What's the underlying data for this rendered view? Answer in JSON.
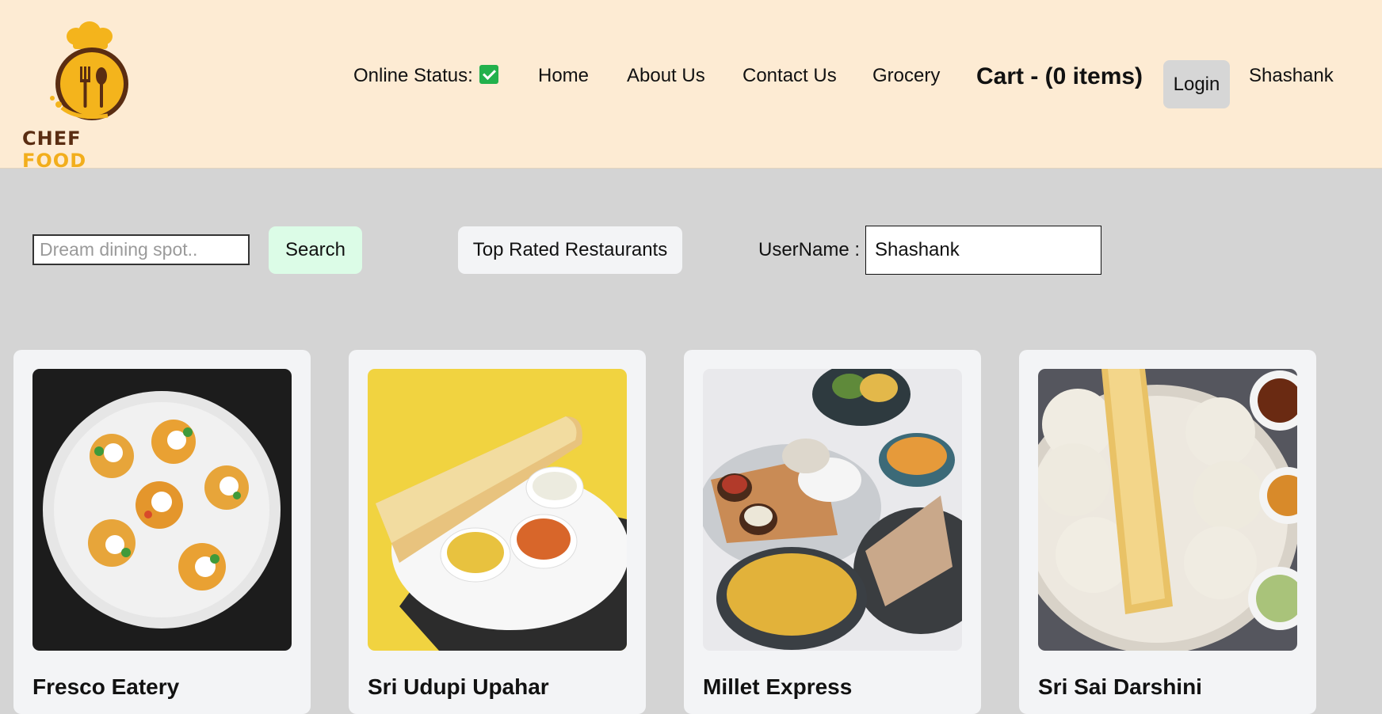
{
  "brand": {
    "word1": "CHEF",
    "word2": "FOOD"
  },
  "nav": {
    "online_status_label": "Online Status:",
    "home": "Home",
    "about": "About Us",
    "contact": "Contact Us",
    "grocery": "Grocery",
    "cart": "Cart - (0 items)",
    "login": "Login",
    "user": "Shashank"
  },
  "controls": {
    "search_placeholder": "Dream dining spot..",
    "search_label": "Search",
    "top_rated_label": "Top Rated Restaurants",
    "username_label": "UserName :",
    "username_value": "Shashank"
  },
  "restaurants": [
    {
      "name": "Fresco Eatery"
    },
    {
      "name": "Sri Udupi Upahar"
    },
    {
      "name": "Millet Express"
    },
    {
      "name": "Sri Sai Darshini"
    }
  ],
  "colors": {
    "header_bg": "#fdebd3",
    "page_bg": "#d4d4d4",
    "card_bg": "#f3f4f6",
    "search_btn_bg": "#dcfce7",
    "online_check": "#22b14c",
    "brand_dark": "#5a2d12",
    "brand_accent": "#f2ae1c"
  },
  "icons": [
    "chef-food-logo-icon",
    "checkbox-checked-icon"
  ]
}
